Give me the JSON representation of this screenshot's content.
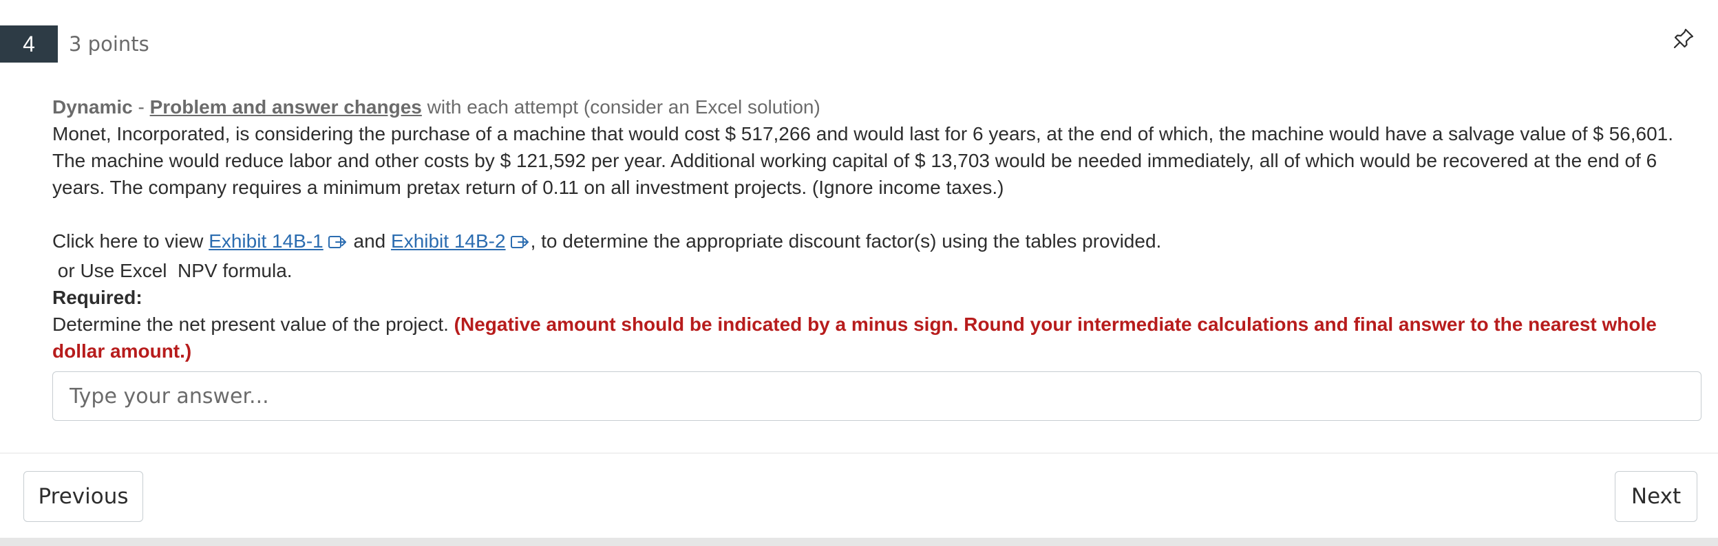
{
  "question": {
    "number": "4",
    "points": "3 points",
    "dynamic_label": "Dynamic",
    "dynamic_dash": " - ",
    "dynamic_link": "Problem and answer changes",
    "dynamic_note": " with each attempt (consider an Excel solution)",
    "problem_text": "Monet, Incorporated, is considering the purchase of a machine that would cost $ 517,266 and would last for 6 years, at the end of which, the machine would have a salvage value of $ 56,601. The machine would reduce labor and other costs by $ 121,592 per year. Additional working capital of $ 13,703 would be needed immediately, all of which would be recovered at the end of 6 years. The company requires a minimum pretax return of 0.11 on all investment projects. (Ignore income taxes.)",
    "exhibit_prefix": "Click here to view ",
    "exhibit_1": "Exhibit 14B-1",
    "exhibit_and": " and ",
    "exhibit_2": "Exhibit 14B-2",
    "exhibit_suffix": ", to determine the appropriate discount factor(s) using the tables provided.",
    "excel_line": " or Use Excel  NPV formula.",
    "required_label": "Required:",
    "determine_text": "Determine the net present value of the project. ",
    "warning_text": "(Negative amount should be indicated by a minus sign. Round your intermediate calculations and final answer to the nearest whole dollar amount.)"
  },
  "answer": {
    "value": "",
    "placeholder": "Type your answer..."
  },
  "navigation": {
    "previous_label": "Previous",
    "next_label": "Next"
  },
  "icons": {
    "pin": "pin-icon",
    "external_link": "external-link-icon"
  },
  "colors": {
    "number_badge_bg": "#2d3b45",
    "link": "#2b6cb0",
    "warning": "#b71c1c",
    "muted": "#6b6b6b"
  }
}
